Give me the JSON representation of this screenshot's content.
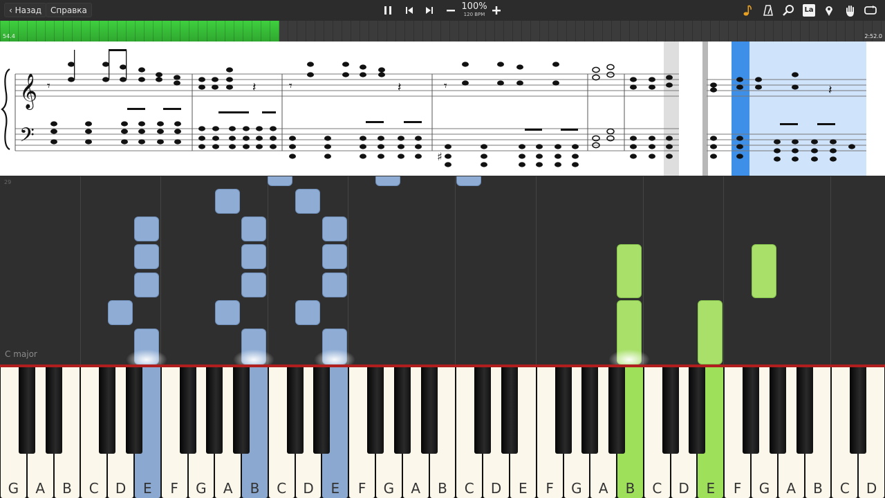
{
  "toolbar": {
    "back_label": "Назад",
    "help_label": "Справка",
    "tempo_percent": "100%",
    "tempo_bpm": "120 BPM",
    "icons": [
      "pause-icon",
      "skip-back-icon",
      "skip-forward-icon",
      "minus-icon",
      "plus-icon",
      "music-note-icon",
      "metronome-icon",
      "magnifier-icon",
      "la-icon",
      "location-pin-icon",
      "hand-icon",
      "loop-icon"
    ],
    "la_label": "La"
  },
  "progress": {
    "elapsed": "54.4",
    "total": "2:52.0",
    "played_fraction": 0.316,
    "fill_color": "#2fa82f"
  },
  "roll": {
    "measure_number": "29",
    "key_signature": "C major",
    "colors": {
      "left_hand": "#8eacd4",
      "right_hand": "#a8e06a"
    }
  },
  "keyboard": {
    "white_keys": [
      "G",
      "A",
      "B",
      "C",
      "D",
      "E",
      "F",
      "G",
      "A",
      "B",
      "C",
      "D",
      "E",
      "F",
      "G",
      "A",
      "B",
      "C",
      "D",
      "E",
      "F",
      "G",
      "A",
      "B",
      "C",
      "D",
      "E",
      "F",
      "G",
      "A",
      "B",
      "C",
      "D"
    ],
    "lit_blue": [
      5,
      9,
      12
    ],
    "lit_green": [
      23,
      26
    ]
  }
}
